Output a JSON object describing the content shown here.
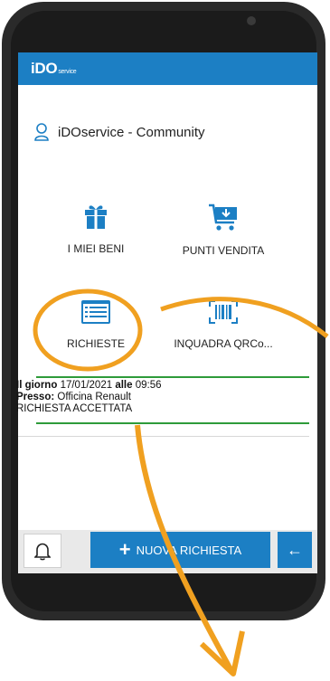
{
  "app": {
    "logo_main": "iDO",
    "logo_sub": "service"
  },
  "header": {
    "community_label": "iDOservice - Community",
    "icon": "user-outline-icon"
  },
  "tiles": [
    {
      "label": "I MIEI BENI",
      "icon": "gift-icon"
    },
    {
      "label": "PUNTI VENDITA",
      "icon": "cart-download-icon"
    },
    {
      "label": "RICHIESTE",
      "icon": "list-card-icon"
    },
    {
      "label": "INQUADRA QRCo...",
      "icon": "barcode-icon"
    }
  ],
  "request": {
    "day_label": "Il giorno",
    "date": "17/01/2021",
    "time_label": "alle",
    "time": "09:56",
    "place_label": "Presso:",
    "place": "Officina Renault",
    "status": "RICHIESTA ACCETTATA"
  },
  "bottom": {
    "bell_icon": "bell-icon",
    "new_request_label": "NUOVA RICHIESTA",
    "back_icon": "arrow-left-icon"
  },
  "colors": {
    "primary": "#1c7fc4",
    "accent_line": "#2e9b3a",
    "annotation": "#f0a020"
  }
}
